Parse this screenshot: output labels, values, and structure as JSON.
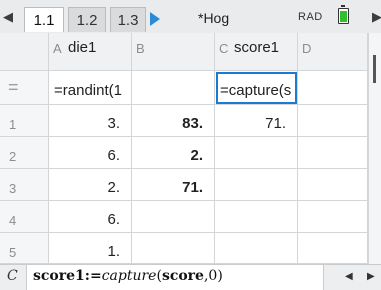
{
  "tabs": [
    {
      "label": "1.1",
      "active": true
    },
    {
      "label": "1.2",
      "active": false
    },
    {
      "label": "1.3",
      "active": false
    }
  ],
  "document_title": "*Hog",
  "angle_mode": "RAD",
  "columns": [
    {
      "letter": "A",
      "name": "die1",
      "formula": "=randint(1"
    },
    {
      "letter": "B",
      "name": "",
      "formula": ""
    },
    {
      "letter": "C",
      "name": "score1",
      "formula": "=capture(s"
    },
    {
      "letter": "D",
      "name": "",
      "formula": ""
    }
  ],
  "rows": [
    {
      "num": "1",
      "a": "3.",
      "b": "83.",
      "c": "71.",
      "d": ""
    },
    {
      "num": "2",
      "a": "6.",
      "b": "2.",
      "c": "",
      "d": ""
    },
    {
      "num": "3",
      "a": "2.",
      "b": "71.",
      "c": "",
      "d": ""
    },
    {
      "num": "4",
      "a": "6.",
      "b": "",
      "c": "",
      "d": ""
    },
    {
      "num": "5",
      "a": "1.",
      "b": "",
      "c": "",
      "d": ""
    }
  ],
  "entry_line": {
    "cell_label": "C",
    "var": "score1",
    "assign": ":=",
    "func": "capture",
    "open": "(",
    "arg": "score",
    "rest": ",0)"
  },
  "icons": {
    "nav_left": "triangle-left-icon",
    "nav_right": "triangle-right-icon",
    "battery": "battery-icon",
    "formula_row": "equals-icon"
  }
}
